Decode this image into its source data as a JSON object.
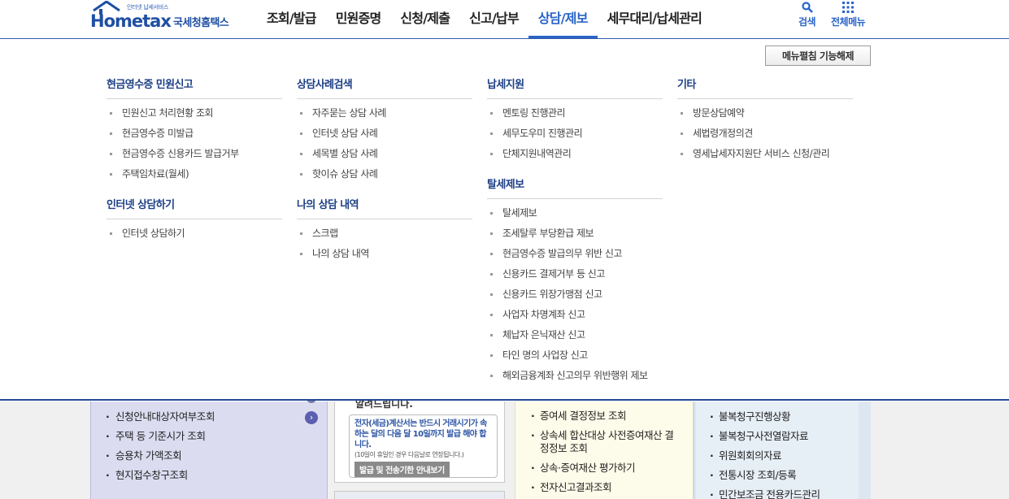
{
  "header": {
    "logo_sub": "인터넷 납세서비스",
    "logo_main": "Hometax",
    "logo_kor": "국세청홈택스",
    "nav": [
      "조회/발급",
      "민원증명",
      "신청/제출",
      "신고/납부",
      "상담/제보",
      "세무대리/납세관리"
    ],
    "active_nav": "상담/제보",
    "search_label": "검색",
    "all_menu_label": "전체메뉴"
  },
  "mega": {
    "unfold_button": "메뉴펼침 기능해제",
    "col1": {
      "sec1": {
        "title": "현금영수증 민원신고",
        "items": [
          "민원신고 처리현황 조회",
          "현금영수증 미발급",
          "현금영수증 신용카드 발급거부",
          "주택임차료(월세)"
        ]
      },
      "sec2": {
        "title": "인터넷 상담하기",
        "items": [
          "인터넷 상담하기"
        ]
      }
    },
    "col2": {
      "sec1": {
        "title": "상담사례검색",
        "items": [
          "자주묻는 상담 사례",
          "인터넷 상담 사례",
          "세목별 상담 사례",
          "핫이슈 상담 사례"
        ]
      },
      "sec2": {
        "title": "나의 상담 내역",
        "items": [
          "스크랩",
          "나의 상담 내역"
        ]
      }
    },
    "col3": {
      "sec1": {
        "title": "납세지원",
        "items": [
          "멘토링 진행관리",
          "세무도우미 진행관리",
          "단체지원내역관리"
        ]
      },
      "sec2": {
        "title": "탈세제보",
        "items": [
          "탈세제보",
          "조세탈루 부당환급 제보",
          "현금영수증 발급의무 위반 신고",
          "신용카드 결제거부 등 신고",
          "신용카드 위장가맹점 신고",
          "사업자 차명계좌 신고",
          "체납자 은닉재산 신고",
          "타인 명의 사업장 신고",
          "해외금융계좌 신고의무 위반행위 제보"
        ]
      }
    },
    "col4": {
      "sec1": {
        "title": "기타",
        "items": [
          "방문상담예약",
          "세법령개정의견",
          "영세납세자지원단 서비스 신청/관리"
        ]
      }
    }
  },
  "background": {
    "col1_items": [
      "신청안내대상자여부조회",
      "주택 등 기준시가 조회",
      "승용차 가액조회",
      "현지접수창구조회"
    ],
    "col2_head": "알려드립니다.",
    "col2_notice_main": "전자(세금)계산서는 반드시 거래시기가 속하는 달의 다음 달 10일까지 발급 해야 합니다.",
    "col2_notice_sub": "(10일이 휴일인 경우 다음날로 연장됩니다.)",
    "col2_notice_button": "발급 및 전송기한 안내보기",
    "col3_items": [
      "증여세 결정정보 조회",
      "상속세 합산대상 사전증여재산 결정정보 조회",
      "상속·증여재산 평가하기",
      "전자신고결과조회"
    ],
    "col4_items": [
      "불복청구진행상황",
      "불복청구사전열람자료",
      "위원회회의자료",
      "전통시장 조회/등록",
      "민간보조금 전용카드관리"
    ]
  }
}
